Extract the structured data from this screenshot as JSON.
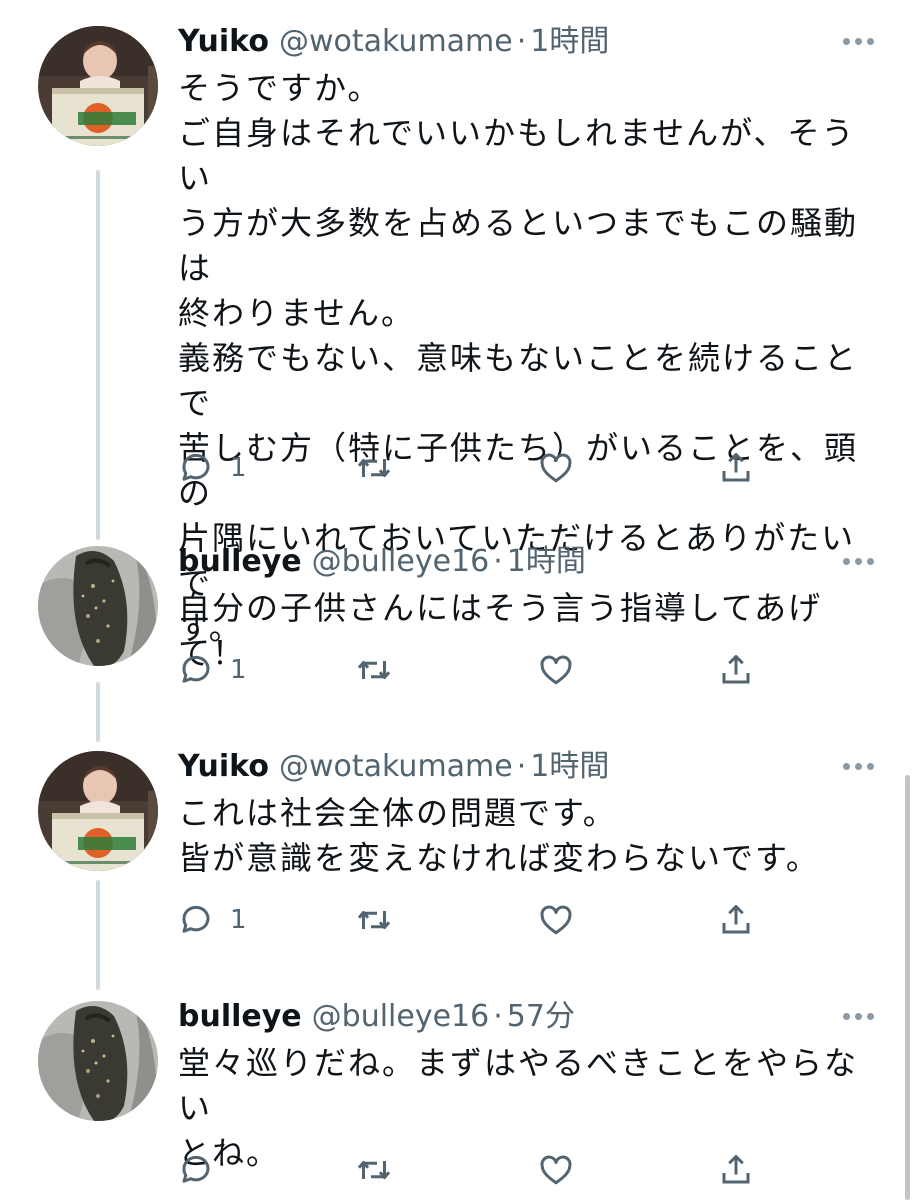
{
  "tweets": [
    {
      "name": "Yuiko",
      "handle": "@wotakumame",
      "separator": "·",
      "time": "1時間",
      "text": "そうですか。\nご自身はそれでいいかもしれませんが、そうい\nう方が大多数を占めるといつまでもこの騒動は\n終わりません。\n義務でもない、意味もないことを続けることで\n苦しむ方（特に子供たち）がいることを、頭の\n片隅にいれておいていただけるとありがたいで\nす。",
      "reply_count": "1",
      "avatar": "baby-photo-avatar"
    },
    {
      "name": "bulleye",
      "handle": "@bulleye16",
      "separator": "·",
      "time": "1時間",
      "text": "自分の子供さんにはそう言う指導してあげて！",
      "reply_count": "1",
      "avatar": "flounder-fish-avatar"
    },
    {
      "name": "Yuiko",
      "handle": "@wotakumame",
      "separator": "·",
      "time": "1時間",
      "text": "これは社会全体の問題です。\n皆が意識を変えなければ変わらないです。",
      "reply_count": "1",
      "avatar": "baby-photo-avatar"
    },
    {
      "name": "bulleye",
      "handle": "@bulleye16",
      "separator": "·",
      "time": "57分",
      "text": "堂々巡りだね。まずはやるべきことをやらない\nとね。",
      "reply_count": "",
      "avatar": "flounder-fish-avatar"
    }
  ],
  "colors": {
    "text": "#0f1419",
    "secondary": "#536471",
    "thread_line": "#cfd9de"
  },
  "icons": [
    "reply-icon",
    "retweet-icon",
    "like-icon",
    "share-icon",
    "more-icon"
  ]
}
